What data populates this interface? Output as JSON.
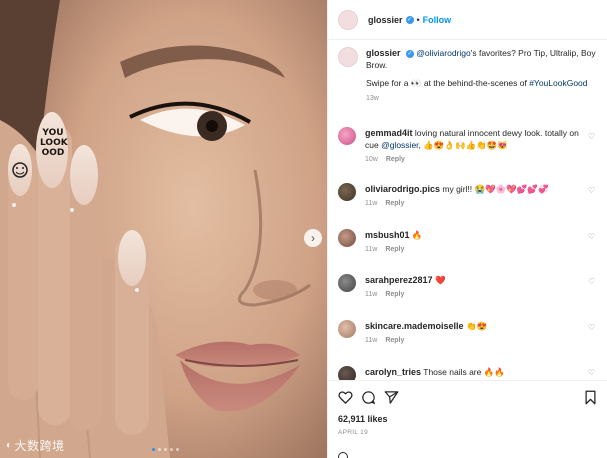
{
  "post": {
    "account": "glossier",
    "follow_label": "Follow",
    "dot_separator": "•",
    "caption_part1": "@oliviarodrigo",
    "caption_part2": "'s favorites? Pro Tip, Ultralip, Boy Brow.",
    "caption_line2a": "Swipe for a 👀 at the behind-the-scenes of ",
    "caption_hashtag": "#YouLookGood",
    "caption_age": "13w",
    "likes": "62,911 likes",
    "date": "APRIL 19"
  },
  "comments": [
    {
      "user": "gemmad4it",
      "text": "loving natural innocent dewy look. totally on cue ",
      "mention": "@glossier",
      "emoji": ", 👍😍👌🙌👍👏🤩😻",
      "age": "10w",
      "reply": "Reply"
    },
    {
      "user": "oliviarodrigo.pics",
      "text": "my girl!! 😭💖🌸💖💕💕💞",
      "age": "11w",
      "reply": "Reply"
    },
    {
      "user": "msbush01",
      "text": "🔥",
      "age": "11w",
      "reply": "Reply"
    },
    {
      "user": "sarahperez2817",
      "text": "❤️",
      "age": "11w",
      "reply": "Reply"
    },
    {
      "user": "skincare.mademoiselle",
      "text": "👏😍",
      "age": "11w",
      "reply": "Reply"
    },
    {
      "user": "carolyn_tries",
      "text": "Those nails are 🔥🔥",
      "age": "",
      "reply": ""
    }
  ],
  "nails_text": [
    "YOU",
    "LOOK",
    "OOD"
  ],
  "watermark": "大数跨境",
  "icons": [
    "verified-badge-icon",
    "heart-icon",
    "comment-icon",
    "share-icon",
    "bookmark-icon",
    "chevron-right-icon",
    "add-comment-icon"
  ],
  "colors": {
    "link": "#00376b",
    "follow": "#0095f6",
    "verified": "#3897f0",
    "muted": "#8e8e8e"
  },
  "carousel": {
    "dots": 5,
    "active": 1
  }
}
